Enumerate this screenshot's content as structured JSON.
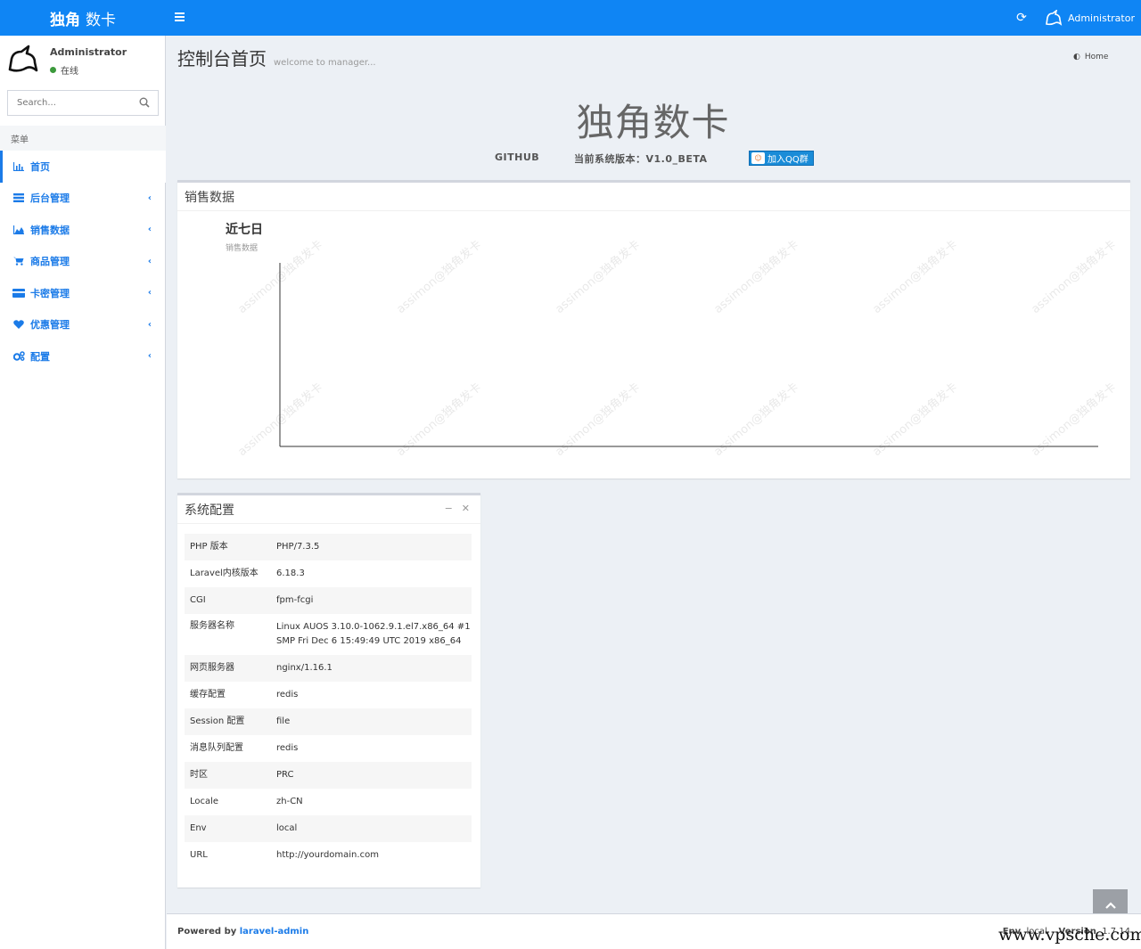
{
  "header": {
    "logo_bold": "独角",
    "logo_rest": "数卡",
    "user_name": "Administrator",
    "accent_color": "#0f85f4"
  },
  "sidebar": {
    "user_name": "Administrator",
    "user_status": "在线",
    "search_placeholder": "Search...",
    "menu_header": "菜单",
    "items": [
      {
        "label": "首页",
        "icon": "bar-chart-icon"
      },
      {
        "label": "后台管理",
        "icon": "tasks-icon"
      },
      {
        "label": "销售数据",
        "icon": "area-chart-icon"
      },
      {
        "label": "商品管理",
        "icon": "cart-icon"
      },
      {
        "label": "卡密管理",
        "icon": "credit-card-icon"
      },
      {
        "label": "优惠管理",
        "icon": "heart-icon"
      },
      {
        "label": "配置",
        "icon": "gears-icon"
      }
    ]
  },
  "content": {
    "title": "控制台首页",
    "subtitle": "welcome to manager...",
    "breadcrumb": "Home",
    "brand_title": "独角数卡",
    "github_label": "GITHUB",
    "version_label": "当前系统版本：V1.0_BETA",
    "qq_label": "加入QQ群"
  },
  "sales": {
    "box_title": "销售数据",
    "chart_title": "近七日",
    "chart_subtitle": "销售数据",
    "watermark": "assimon@独角发卡"
  },
  "chart_data": {
    "type": "line",
    "title": "近七日",
    "subtitle": "销售数据",
    "series": [],
    "grid": false
  },
  "system": {
    "box_title": "系统配置",
    "rows": [
      {
        "key": "PHP 版本",
        "value": "PHP/7.3.5"
      },
      {
        "key": "Laravel内核版本",
        "value": "6.18.3"
      },
      {
        "key": "CGI",
        "value": "fpm-fcgi"
      },
      {
        "key": "服务器名称",
        "value": "Linux AUOS 3.10.0-1062.9.1.el7.x86_64 #1",
        "value2": "SMP Fri Dec 6 15:49:49 UTC 2019 x86_64"
      },
      {
        "key": "网页服务器",
        "value": "nginx/1.16.1"
      },
      {
        "key": "缓存配置",
        "value": "redis"
      },
      {
        "key": "Session 配置",
        "value": "file"
      },
      {
        "key": "消息队列配置",
        "value": "redis"
      },
      {
        "key": "时区",
        "value": "PRC"
      },
      {
        "key": "Locale",
        "value": "zh-CN"
      },
      {
        "key": "Env",
        "value": "local"
      },
      {
        "key": "URL",
        "value": "http://yourdomain.com"
      }
    ]
  },
  "footer": {
    "powered_prefix": "Powered by ",
    "powered_link": "laravel-admin",
    "env_label": "Env",
    "env_value": "local",
    "version_label": "Version",
    "version_value": "1.7.14",
    "site_watermark": "www.vpsche.com"
  }
}
